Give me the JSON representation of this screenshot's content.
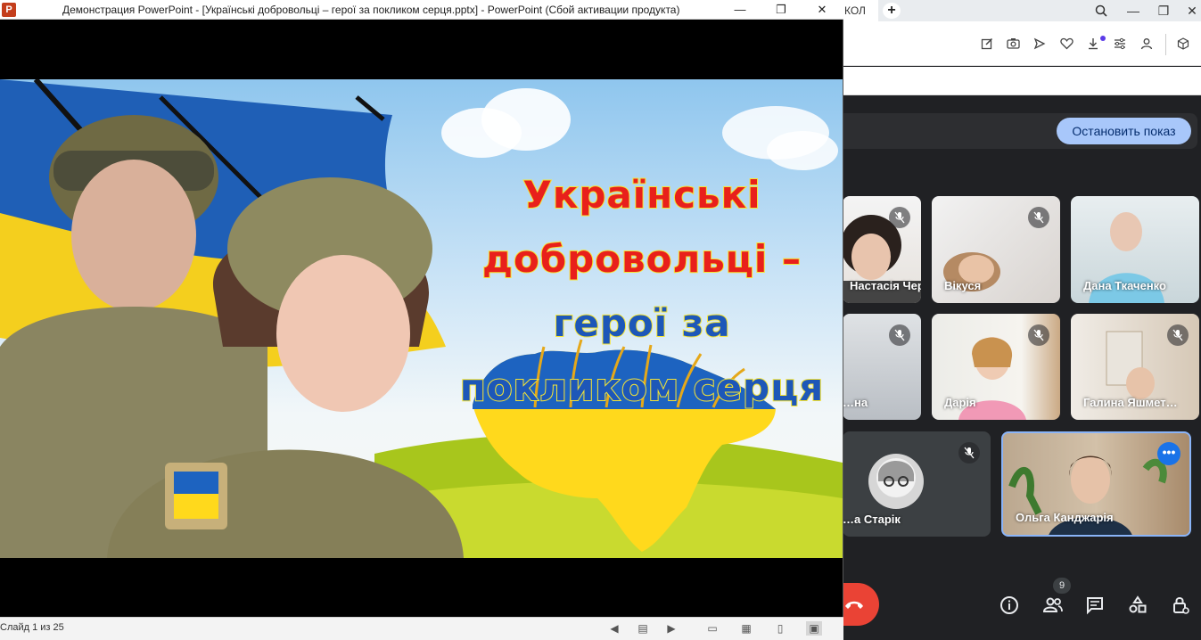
{
  "browser": {
    "tab_fragment": "КОЛ",
    "newtab": "+",
    "window_controls": [
      "⌕",
      "—",
      "❐",
      "✕"
    ],
    "toolbar_icons": [
      "edit-icon",
      "camera-icon",
      "send-icon",
      "heart-icon",
      "download-icon",
      "sliders-icon",
      "profile-icon",
      "cube-icon"
    ]
  },
  "meet": {
    "stop_presenting": "Остановить показ",
    "participants": [
      {
        "name": "Настасія Чер…",
        "muted": true
      },
      {
        "name": "Вікуся",
        "muted": true
      },
      {
        "name": "Дана Ткаченко",
        "muted": false
      },
      {
        "name": "…на",
        "muted": true
      },
      {
        "name": "Дарія",
        "muted": true
      },
      {
        "name": "Галина Яшмет…",
        "muted": true
      },
      {
        "name": "…а Старік",
        "muted": true
      },
      {
        "name": "Ольга Канджарія",
        "muted": false
      }
    ],
    "people_count": "9"
  },
  "ppt": {
    "window_title": "Демонстрация PowerPoint - [Українські добровольці – герої за покликом серця.pptx] - PowerPoint (Сбой активации продукта)",
    "logo": "P",
    "controls": [
      "—",
      "❐",
      "✕"
    ],
    "slide": {
      "title_line1": "Українські",
      "title_line2": "добровольці –",
      "title_line3": "герої за",
      "title_line4": "покликом серця"
    },
    "status": "Слайд 1 из 25"
  },
  "colors": {
    "ukraine_blue": "#1d57b8",
    "ukraine_yellow": "#f7d117",
    "meet_accent": "#a8c7fa",
    "hangup_red": "#ea4335"
  }
}
